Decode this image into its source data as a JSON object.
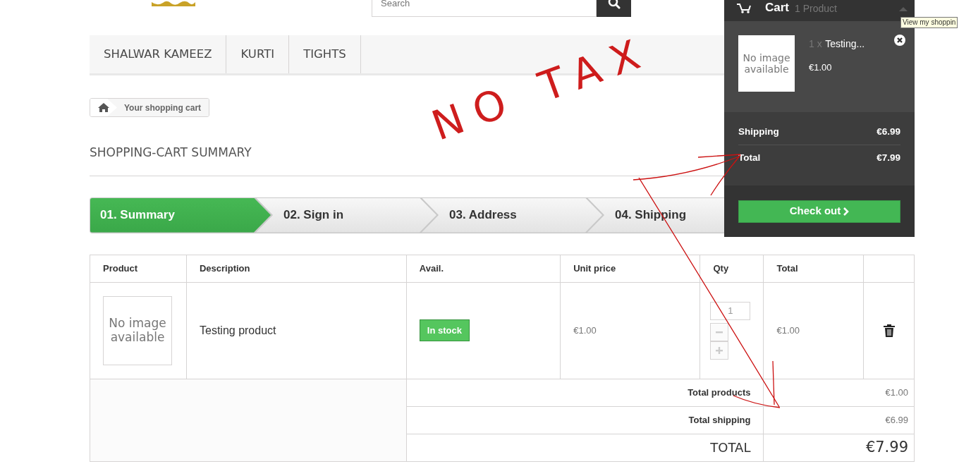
{
  "header": {
    "search": {
      "placeholder": "Search"
    }
  },
  "menu": [
    {
      "label": "SHALWAR KAMEEZ"
    },
    {
      "label": "KURTI"
    },
    {
      "label": "TIGHTS"
    }
  ],
  "breadcrumb": {
    "current": "Your shopping cart"
  },
  "heading": "SHOPPING-CART SUMMARY",
  "steps": [
    {
      "label": "01. Summary",
      "selected": true
    },
    {
      "label": "02. Sign in",
      "selected": false
    },
    {
      "label": "03. Address",
      "selected": false
    },
    {
      "label": "04. Shipping",
      "selected": false
    }
  ],
  "table": {
    "columns": [
      "Product",
      "Description",
      "Avail.",
      "Unit price",
      "Qty",
      "Total"
    ],
    "rows": [
      {
        "image": "No image available",
        "description": "Testing product",
        "availability": "In stock",
        "unit_price": "€1.00",
        "qty": "1",
        "total": "€1.00"
      }
    ],
    "totals": [
      {
        "label": "Total products",
        "value": "€1.00",
        "kind": "sub"
      },
      {
        "label": "Total shipping",
        "value": "€6.99",
        "kind": "sub"
      },
      {
        "label": "TOTAL",
        "value": "€7.99",
        "kind": "grand"
      }
    ]
  },
  "cart": {
    "title": "Cart",
    "count": "1 Product",
    "items": [
      {
        "image": "No image available",
        "qty": "1",
        "times": "x",
        "name": "Testing...",
        "price": "€1.00"
      }
    ],
    "summary": [
      {
        "label": "Shipping",
        "value": "€6.99"
      },
      {
        "label": "Total",
        "value": "€7.99"
      }
    ],
    "checkout": "Check out"
  },
  "tooltip": "View my shoppin",
  "annotation": {
    "text": "NO TAX"
  }
}
